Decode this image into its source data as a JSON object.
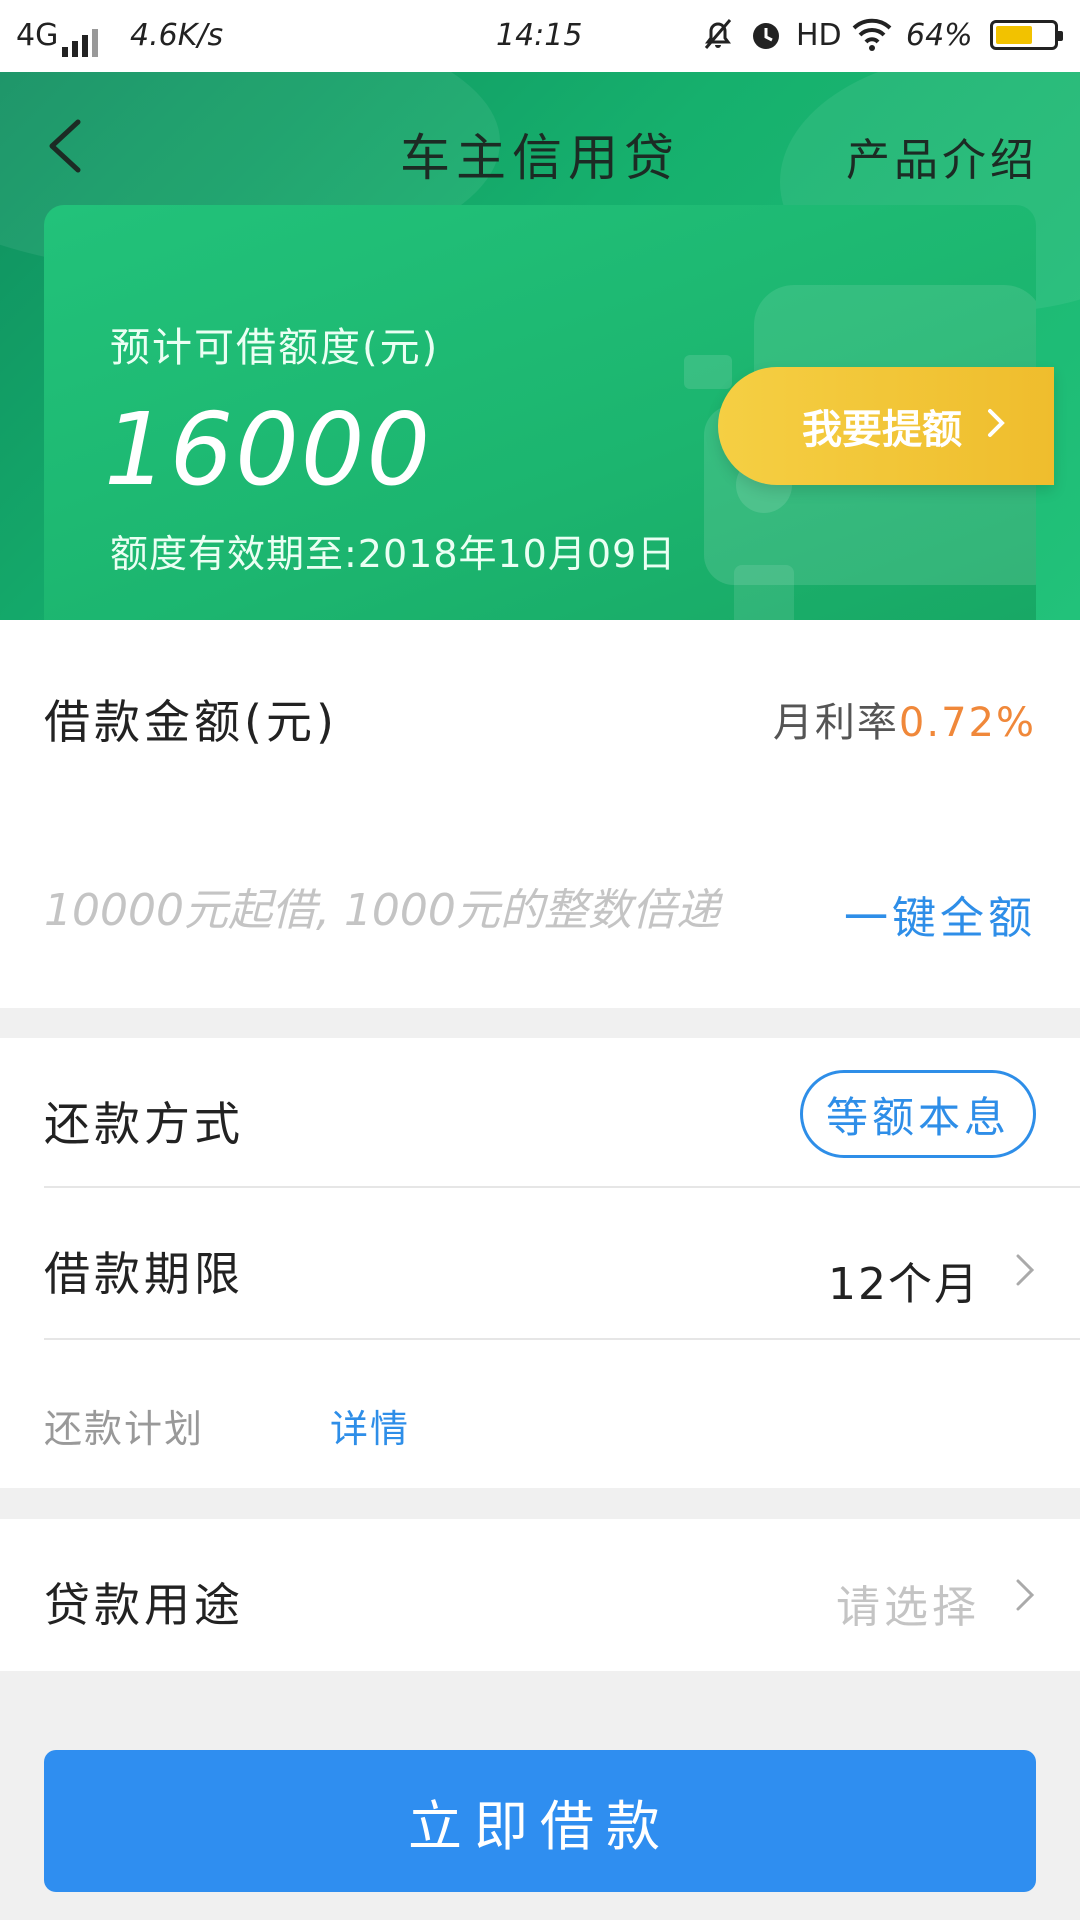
{
  "status_bar": {
    "network": "4G",
    "speed": "4.6K/s",
    "time": "14:15",
    "hd": "HD",
    "battery": "64%",
    "battery_level": 0.64,
    "battery_color": "#f2c200"
  },
  "header": {
    "title": "车主信用贷",
    "product_intro": "产品介绍",
    "back_icon": "chevron-left-icon"
  },
  "credit": {
    "label": "预计可借额度(元)",
    "amount": "16000",
    "expiry": "额度有效期至:2018年10月09日",
    "raise_button": "我要提额"
  },
  "loan_amount": {
    "label": "借款金额(元)",
    "rate_label": "月利率",
    "rate_value": "0.72%",
    "placeholder": "10000元起借, 1000元的整数倍递",
    "full_amount": "一键全额"
  },
  "repayment": {
    "method_label": "还款方式",
    "method_value": "等额本息",
    "term_label": "借款期限",
    "term_value": "12个月",
    "plan_label": "还款计划",
    "plan_detail": "详情"
  },
  "purpose": {
    "label": "贷款用途",
    "value": "请选择"
  },
  "submit": {
    "label": "立即借款"
  },
  "colors": {
    "primary_green": "#16b06d",
    "accent_yellow": "#efbd2d",
    "link_blue": "#2e8ee8",
    "rate_orange": "#f0883a",
    "button_blue": "#2f8ef0"
  }
}
